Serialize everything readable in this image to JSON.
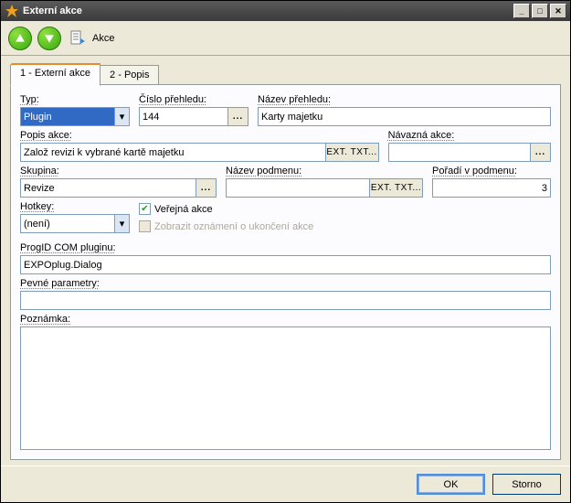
{
  "window": {
    "title": "Externí akce"
  },
  "toolbar": {
    "actions_label": "Akce"
  },
  "tabs": {
    "t1": "1 - Externí akce",
    "t2": "2 - Popis"
  },
  "form": {
    "typ_label": "Typ:",
    "typ_value": "Plugin",
    "cislo_label": "Číslo přehledu:",
    "cislo_value": "144",
    "nazev_label": "Název přehledu:",
    "nazev_value": "Karty majetku",
    "popis_label": "Popis akce:",
    "popis_value": "Založ revizi k vybrané kartě majetku",
    "navazna_label": "Návazná akce:",
    "navazna_value": "",
    "skupina_label": "Skupina:",
    "skupina_value": "Revize",
    "nazevpod_label": "Název podmenu:",
    "nazevpod_value": "",
    "poradi_label": "Pořadí v podmenu:",
    "poradi_value": "3",
    "hotkey_label": "Hotkey:",
    "hotkey_value": "(není)",
    "verejna_label": "Veřejná akce",
    "oznam_label": "Zobrazit oznámení o ukončení akce",
    "progid_label": "ProgID COM pluginu:",
    "progid_value": "EXPOplug.Dialog",
    "pevne_label": "Pevné parametry:",
    "pevne_value": "",
    "poznamka_label": "Poznámka:",
    "ext_btn": "EXT. TXT...",
    "ellipsis": "..."
  },
  "footer": {
    "ok": "OK",
    "storno": "Storno"
  }
}
